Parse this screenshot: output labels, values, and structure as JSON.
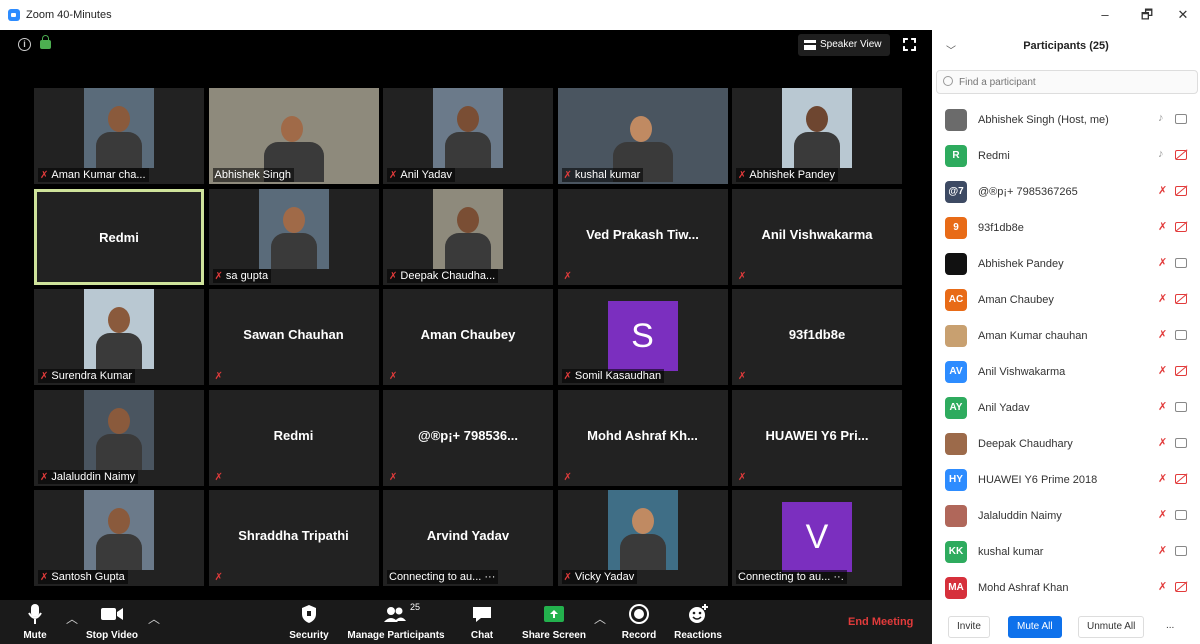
{
  "window": {
    "title": "Zoom 40-Minutes",
    "minimize": "–",
    "restore": "🗗",
    "close": "✕"
  },
  "top": {
    "speaker_view": "Speaker View"
  },
  "tiles": [
    {
      "name": "",
      "caption": "Aman Kumar cha...",
      "muted": true,
      "video": true
    },
    {
      "name": "",
      "caption": "Abhishek Singh",
      "muted": false,
      "video": true
    },
    {
      "name": "",
      "caption": "Anil Yadav",
      "muted": true,
      "video": true
    },
    {
      "name": "",
      "caption": "kushal kumar",
      "muted": true,
      "video": true
    },
    {
      "name": "",
      "caption": "Abhishek Pandey",
      "muted": true,
      "video": true
    },
    {
      "name": "Redmi",
      "caption": "",
      "muted": false,
      "video": false
    },
    {
      "name": "",
      "caption": "sa gupta",
      "muted": true,
      "video": true
    },
    {
      "name": "",
      "caption": "Deepak Chaudha...",
      "muted": true,
      "video": true
    },
    {
      "name": "Ved Prakash Tiw...",
      "caption": "",
      "muted": true,
      "video": false
    },
    {
      "name": "Anil Vishwakarma",
      "caption": "",
      "muted": true,
      "video": false
    },
    {
      "name": "",
      "caption": "Surendra Kumar",
      "muted": true,
      "video": true
    },
    {
      "name": "Sawan Chauhan",
      "caption": "",
      "muted": true,
      "video": false
    },
    {
      "name": "Aman Chaubey",
      "caption": "",
      "muted": true,
      "video": false
    },
    {
      "name": "",
      "caption": "Somil Kasaudhan",
      "muted": true,
      "avatar": "S",
      "avatar_color": "#7b2fbf"
    },
    {
      "name": "93f1db8e",
      "caption": "",
      "muted": true,
      "video": false
    },
    {
      "name": "",
      "caption": "Jalaluddin Naimy",
      "muted": true,
      "video": true
    },
    {
      "name": "Redmi",
      "caption": "",
      "muted": true,
      "video": false
    },
    {
      "name": "@®p¡+ 798536...",
      "caption": "",
      "muted": true,
      "video": false
    },
    {
      "name": "Mohd Ashraf Kh...",
      "caption": "",
      "muted": true,
      "video": false
    },
    {
      "name": "HUAWEI Y6 Pri...",
      "caption": "",
      "muted": true,
      "video": false
    },
    {
      "name": "",
      "caption": "Santosh Gupta",
      "muted": true,
      "video": true
    },
    {
      "name": "Shraddha Tripathi",
      "caption": "",
      "muted": true,
      "video": false
    },
    {
      "name": "Arvind Yadav",
      "caption": "Connecting to au... ···",
      "muted": false,
      "video": false
    },
    {
      "name": "",
      "caption": "Vicky Yadav",
      "muted": true,
      "video": true
    },
    {
      "name": "",
      "caption": "Connecting to au... ··.",
      "muted": false,
      "avatar": "V",
      "avatar_color": "#7b2fbf"
    }
  ],
  "toolbar": {
    "mute": "Mute",
    "stop_video": "Stop Video",
    "security": "Security",
    "manage_participants": "Manage Participants",
    "participant_count": "25",
    "chat": "Chat",
    "share_screen": "Share Screen",
    "record": "Record",
    "reactions": "Reactions",
    "end_meeting": "End Meeting"
  },
  "panel": {
    "title": "Participants (25)",
    "search_placeholder": "Find a participant",
    "invite": "Invite",
    "mute_all": "Mute All",
    "unmute_all": "Unmute All",
    "more": "...",
    "participants": [
      {
        "name": "Abhishek Singh (Host, me)",
        "initials": "",
        "color": "#6b6b6b",
        "mic": "on",
        "cam": "on"
      },
      {
        "name": "Redmi",
        "initials": "R",
        "color": "#2eab5e",
        "mic": "on",
        "cam": "off"
      },
      {
        "name": "@®p¡+ 7985367265",
        "initials": "@7",
        "color": "#3d4a63",
        "mic": "off",
        "cam": "off"
      },
      {
        "name": "93f1db8e",
        "initials": "9",
        "color": "#e86b17",
        "mic": "off",
        "cam": "off"
      },
      {
        "name": "Abhishek Pandey",
        "initials": "",
        "color": "#111111",
        "mic": "off",
        "cam": "on"
      },
      {
        "name": "Aman Chaubey",
        "initials": "AC",
        "color": "#e86b17",
        "mic": "off",
        "cam": "off"
      },
      {
        "name": "Aman Kumar chauhan",
        "initials": "",
        "color": "#c8a070",
        "mic": "off",
        "cam": "on"
      },
      {
        "name": "Anil Vishwakarma",
        "initials": "AV",
        "color": "#2d8cff",
        "mic": "off",
        "cam": "off"
      },
      {
        "name": "Anil Yadav",
        "initials": "AY",
        "color": "#2eab5e",
        "mic": "off",
        "cam": "on"
      },
      {
        "name": "Deepak Chaudhary",
        "initials": "",
        "color": "#9c6a4a",
        "mic": "off",
        "cam": "on"
      },
      {
        "name": "HUAWEI Y6 Prime 2018",
        "initials": "HY",
        "color": "#2d8cff",
        "mic": "off",
        "cam": "off"
      },
      {
        "name": "Jalaluddin Naimy",
        "initials": "",
        "color": "#b0675a",
        "mic": "off",
        "cam": "on"
      },
      {
        "name": "kushal kumar",
        "initials": "KK",
        "color": "#2eab5e",
        "mic": "off",
        "cam": "on"
      },
      {
        "name": "Mohd Ashraf Khan",
        "initials": "MA",
        "color": "#d6303b",
        "mic": "off",
        "cam": "off"
      }
    ]
  }
}
